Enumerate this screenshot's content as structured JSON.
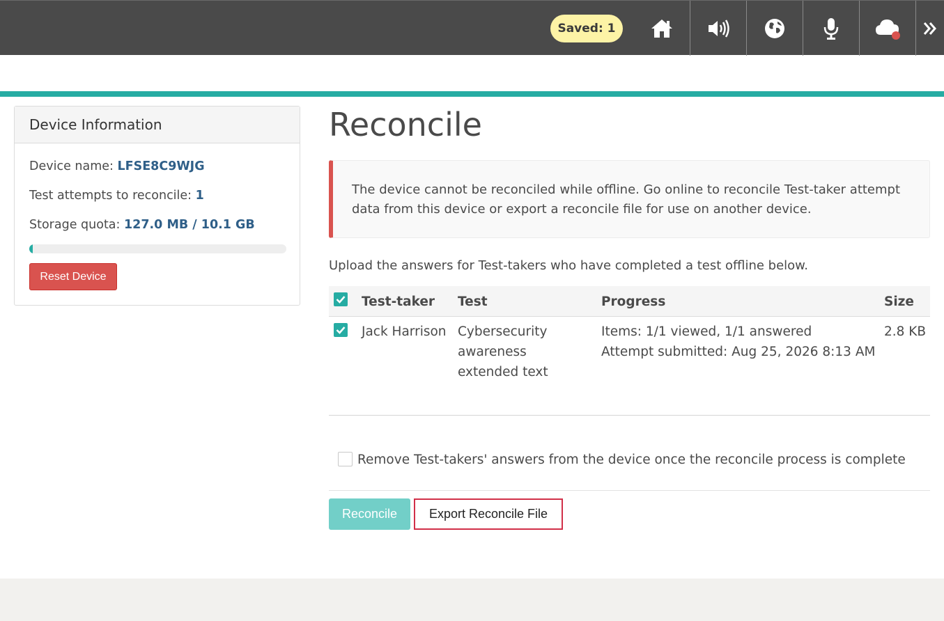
{
  "header": {
    "saved_badge": "Saved: 1",
    "icons": [
      "home-icon",
      "volume-icon",
      "globe-icon",
      "microphone-icon",
      "cloud-offline-icon",
      "chevron-double-right-icon"
    ],
    "colors": {
      "bar": "#4a4a4a",
      "badge": "#fdf3a6",
      "offline_dot": "#d9534f"
    }
  },
  "device_panel": {
    "title": "Device Information",
    "device_name_label": "Device name:",
    "device_name_value": "LFSE8C9WJG",
    "attempts_label": "Test attempts to reconcile:",
    "attempts_value": "1",
    "quota_label": "Storage quota:",
    "quota_value": "127.0 MB / 10.1 GB",
    "quota_fraction": 0.0123,
    "reset_button": "Reset Device"
  },
  "main": {
    "title": "Reconcile",
    "alert": "The device cannot be reconciled while offline. Go online to reconcile Test-taker attempt data from this device or export a reconcile file for use on another device.",
    "upload_text": "Upload the answers for Test-takers who have completed a test offline below.",
    "table": {
      "headers": [
        "Test-taker",
        "Test",
        "Progress",
        "Size"
      ],
      "select_all_checked": true,
      "rows": [
        {
          "checked": true,
          "test_taker": "Jack Harrison",
          "test_lines": [
            "Cybersecurity",
            "awareness",
            "extended text"
          ],
          "progress_items": "Items: 1/1 viewed, 1/1 answered",
          "progress_submitted": "Attempt submitted: Aug 25, 2026 8:13 AM",
          "size": "2.8 KB"
        }
      ]
    },
    "remove_label": "Remove Test-takers' answers from the device once the reconcile process is complete",
    "remove_checked": false,
    "reconcile_button": "Reconcile",
    "export_button": "Export Reconcile File",
    "colors": {
      "accent": "#26aca3",
      "danger": "#d9534f",
      "title": "#2f5f88"
    }
  }
}
